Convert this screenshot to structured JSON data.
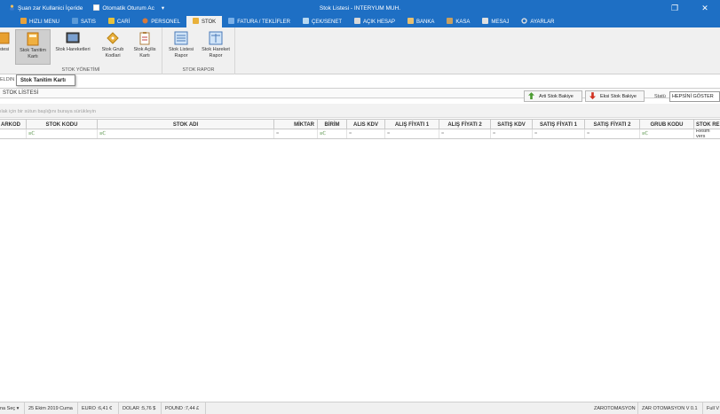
{
  "titlebar": {
    "title": "Stok Listesi - INTERYUM MUH.",
    "user_status": "Şuan zar Kullanici İçeride",
    "auto_login": "Otomatik Oturum Ac",
    "dropdown": "▾",
    "restore": "❐",
    "close": "✕"
  },
  "menu": {
    "tabs": [
      {
        "label": "HIZLI MENU",
        "color": "#e8a23a"
      },
      {
        "label": "SATIS",
        "color": "#5a9ad8"
      },
      {
        "label": "CARİ",
        "color": "#e8c23a"
      },
      {
        "label": "PERSONEL",
        "color": "#d87a3a"
      },
      {
        "label": "STOK",
        "color": "#e8b03a"
      },
      {
        "label": "FATURA / TEKLİFLER",
        "color": "#7ab0e8"
      },
      {
        "label": "ÇEK/SENET",
        "color": "#b8d8f0"
      },
      {
        "label": "AÇIK HESAP",
        "color": "#d8d8d8"
      },
      {
        "label": "BANKA",
        "color": "#e8c070"
      },
      {
        "label": "KASA",
        "color": "#c8a060"
      },
      {
        "label": "MESAJ",
        "color": "#e0e0e0"
      },
      {
        "label": "AYARLAR",
        "color": "#e0e0e0"
      }
    ]
  },
  "ribbon": {
    "group1_label": "STOK YÖNETİMİ",
    "group2_label": "STOK RAPOR",
    "buttons": [
      {
        "label1": "istesi",
        "label2": ""
      },
      {
        "label1": "Stok Tanitim",
        "label2": "Kartı"
      },
      {
        "label1": "Stok Hareketleri",
        "label2": ""
      },
      {
        "label1": "Stok Grub",
        "label2": "Kodlari"
      },
      {
        "label1": "Stok Açilis",
        "label2": "Kartı"
      },
      {
        "label1": "Stok Listesi",
        "label2": "Rapor"
      },
      {
        "label1": "Stok Hareket",
        "label2": "Rapor"
      }
    ]
  },
  "tooltip": "Stok Tanitim Kartı",
  "tabstrip_label": "ELDIN",
  "panel": {
    "title": "STOK LİSTESİ",
    "plus_button": "Arti Stok Bakiye",
    "minus_button": "Eksi Stok Bakiye",
    "status_label": "Statü",
    "status_value": "HEPSİNİ GÖSTER"
  },
  "group_hint": "ılak için bir sütun başlığını buraya sürükleyin",
  "grid": {
    "columns": [
      "ARKOD",
      "STOK KODU",
      "STOK ADI",
      "MİKTAR",
      "BİRİM",
      "ALIS KDV",
      "ALIŞ FİYATI 1",
      "ALIŞ FİYATI 2",
      "SATIŞ KDV",
      "SATIŞ FİYATI 1",
      "SATIŞ FİYATI 2",
      "GRUB KODU",
      "STOK RE"
    ],
    "filters": [
      "",
      "≡ℂ",
      "≡ℂ",
      "=",
      "≡ℂ",
      "=",
      "=",
      "=",
      "=",
      "=",
      "=",
      "≡ℂ",
      "Resim vers"
    ]
  },
  "statusbar": {
    "items": [
      "na Seç ▾",
      "25 Ekim 2019 Cuma",
      "EURO :6,41 €",
      "DOLAR :5,76 $",
      "POUND :7,44 £",
      "ZAROTOMASYON",
      "ZAR OTOMASYON V 0.1",
      "Full V"
    ]
  }
}
